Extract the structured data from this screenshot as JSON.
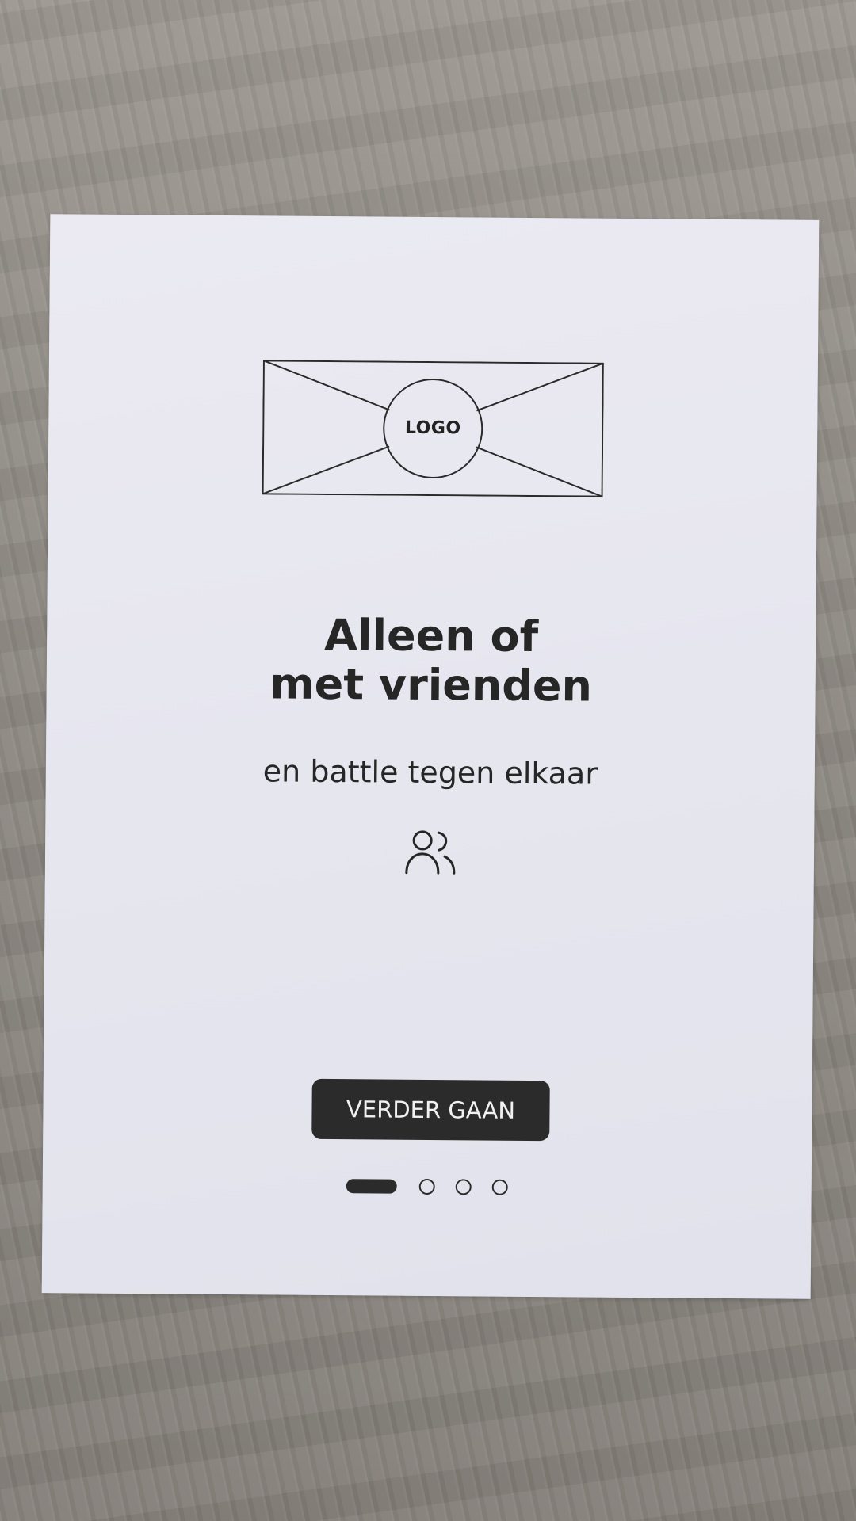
{
  "logo": {
    "label": "LOGO"
  },
  "intro": {
    "title_line1": "Alleen of",
    "title_line2": "met vrienden",
    "subtitle": "en battle tegen elkaar",
    "icon": "users-icon"
  },
  "actions": {
    "continue_label": "VERDER GAAN"
  },
  "pager": {
    "total": 4,
    "active_index": 0
  },
  "colors": {
    "ink": "#262626",
    "button_bg": "#2b2b2b",
    "button_text": "#f1f1f1",
    "paper": "#e8e8f0"
  }
}
